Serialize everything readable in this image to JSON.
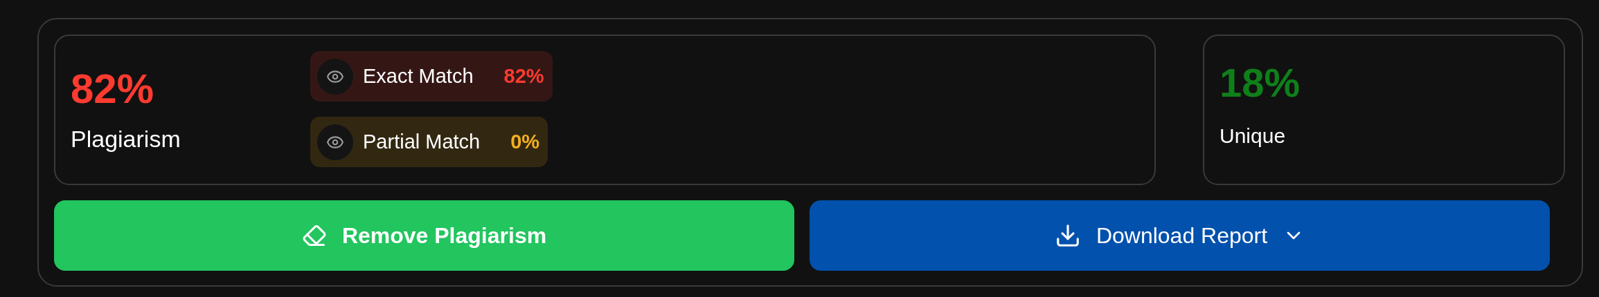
{
  "plagiarism": {
    "percent": "82%",
    "label": "Plagiarism",
    "color": "#ff3b30"
  },
  "matches": [
    {
      "label": "Exact Match",
      "percent": "82%",
      "color": "#ff3b30"
    },
    {
      "label": "Partial Match",
      "percent": "0%",
      "color": "#f2b01e"
    }
  ],
  "unique": {
    "percent": "18%",
    "label": "Unique",
    "color": "#0f7f1a"
  },
  "buttons": [
    {
      "kind": "remove",
      "label": "Remove Plagiarism"
    },
    {
      "kind": "download",
      "label": "Download Report"
    }
  ]
}
